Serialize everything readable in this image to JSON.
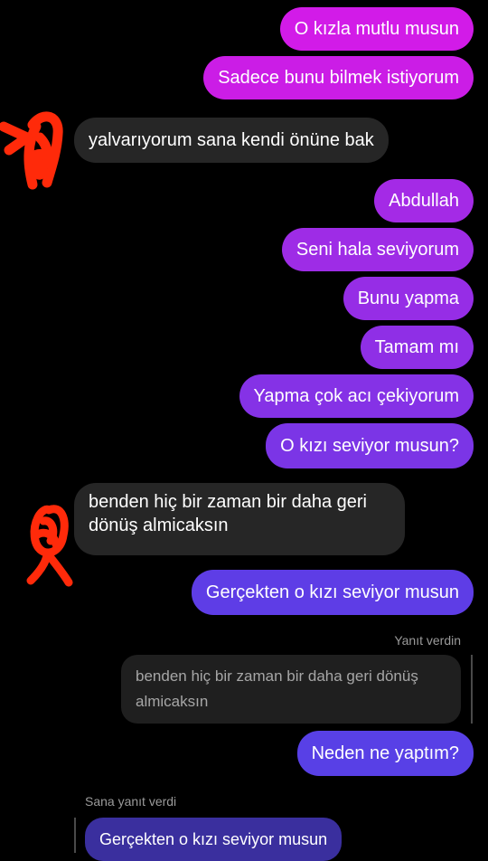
{
  "colors": {
    "background": "#000000",
    "incoming_bubble": "#262626",
    "reply_quote_bubble": "#1f1f1f",
    "scribble_red": "#ff2a0a"
  },
  "messages": [
    {
      "id": "m1",
      "direction": "outgoing",
      "text": "O kızla mutlu musun"
    },
    {
      "id": "m2",
      "direction": "outgoing",
      "text": "Sadece bunu bilmek istiyorum"
    },
    {
      "id": "m3",
      "direction": "incoming",
      "text": "yalvarıyorum sana kendi önüne bak"
    },
    {
      "id": "m4",
      "direction": "outgoing",
      "text": "Abdullah"
    },
    {
      "id": "m5",
      "direction": "outgoing",
      "text": "Seni hala seviyorum"
    },
    {
      "id": "m6",
      "direction": "outgoing",
      "text": "Bunu yapma"
    },
    {
      "id": "m7",
      "direction": "outgoing",
      "text": "Tamam mı"
    },
    {
      "id": "m8",
      "direction": "outgoing",
      "text": "Yapma çok acı çekiyorum"
    },
    {
      "id": "m9",
      "direction": "outgoing",
      "text": "O kızı seviyor musun?"
    },
    {
      "id": "m10",
      "direction": "incoming",
      "text": "benden hiç bir zaman bir daha geri dönüş almicaksın"
    },
    {
      "id": "m11",
      "direction": "outgoing",
      "text": "Gerçekten o kızı seviyor musun"
    },
    {
      "id": "m12",
      "direction": "outgoing",
      "text": "Neden ne yaptım?",
      "reply_label": "Yanıt verdin",
      "quoted_text": "benden hiç bir zaman bir daha geri dönüş almicaksın"
    },
    {
      "id": "m13",
      "direction": "incoming",
      "reply_label": "Sana yanıt verdi",
      "quoted_text": "Gerçekten o kızı seviyor musun"
    }
  ]
}
